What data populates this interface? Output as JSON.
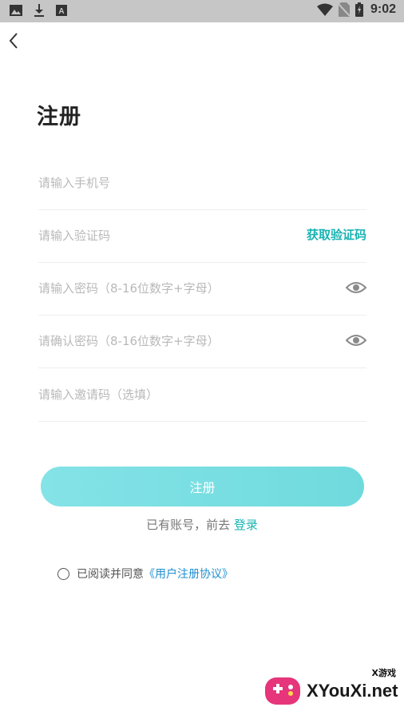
{
  "status_bar": {
    "time": "9:02",
    "left_icons": [
      "image-icon",
      "download-icon",
      "font-icon"
    ],
    "right_icons": [
      "wifi-icon",
      "no-sim-icon",
      "battery-icon"
    ]
  },
  "nav": {
    "back_icon": "chevron-left-icon"
  },
  "title": "注册",
  "form": {
    "phone_placeholder": "请输入手机号",
    "code_placeholder": "请输入验证码",
    "get_code_label": "获取验证码",
    "password_placeholder": "请输入密码（8-16位数字+字母）",
    "confirm_placeholder": "请确认密码（8-16位数字+字母）",
    "invite_placeholder": "请输入邀请码（选填）"
  },
  "register_button": "注册",
  "login_prompt": {
    "text": "已有账号，前去 ",
    "link": "登录"
  },
  "agreement": {
    "text": "已阅读并同意",
    "link": "《用户注册协议》",
    "checked": false
  },
  "watermark": {
    "brand": "XYouXi.net",
    "top_label": "X游戏"
  },
  "colors": {
    "accent": "#19b3b3",
    "button_start": "#84e3e7",
    "button_end": "#6fdadd",
    "link_blue": "#1f8fd0",
    "status_bar": "#c6c6c6"
  }
}
